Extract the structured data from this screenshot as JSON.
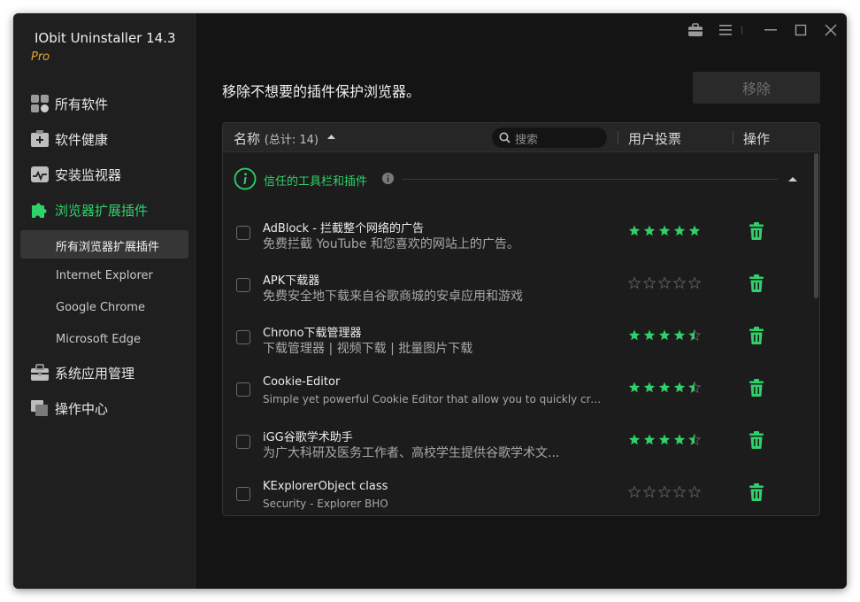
{
  "app": {
    "title": "IObit Uninstaller 14.3",
    "edition": "Pro"
  },
  "sidebar": {
    "items": [
      {
        "label": "所有软件",
        "icon": "grid-icon"
      },
      {
        "label": "软件健康",
        "icon": "medkit-icon"
      },
      {
        "label": "安装监视器",
        "icon": "monitor-icon"
      },
      {
        "label": "浏览器扩展插件",
        "icon": "puzzle-icon",
        "active": true
      },
      {
        "label": "系统应用管理",
        "icon": "briefcase-icon"
      },
      {
        "label": "操作中心",
        "icon": "flag-icon"
      }
    ],
    "subitems": [
      {
        "label": "所有浏览器扩展插件",
        "active": true
      },
      {
        "label": "Internet Explorer"
      },
      {
        "label": "Google Chrome"
      },
      {
        "label": "Microsoft Edge"
      }
    ]
  },
  "main": {
    "heading": "移除不想要的插件保护浏览器。",
    "remove_label": "移除"
  },
  "table": {
    "name_col": "名称",
    "count_label": "(总计: 14)",
    "search_placeholder": "搜索",
    "votes_col": "用户投票",
    "action_col": "操作",
    "group_label": "信任的工具栏和插件",
    "rows": [
      {
        "title": "AdBlock - 拦截整个网络的广告",
        "desc": "免费拦截 YouTube 和您喜欢的网站上的广告。",
        "rating": 5
      },
      {
        "title": "APK下载器",
        "desc": "免费安全地下载来自谷歌商城的安卓应用和游戏",
        "rating": 0
      },
      {
        "title": "Chrono下载管理器",
        "desc": "下载管理器 | 视频下载 | 批量图片下载",
        "rating": 4.5
      },
      {
        "title": "Cookie-Editor",
        "desc": "Simple yet powerful Cookie Editor that allow you to quickly crea...",
        "rating": 4.5
      },
      {
        "title": "iGG谷歌学术助手",
        "desc": "为广大科研及医务工作者、高校学生提供谷歌学术文...",
        "rating": 4.5
      },
      {
        "title": "KExplorerObject class",
        "desc": "Security - Explorer BHO",
        "rating": 0
      }
    ]
  },
  "colors": {
    "accent_green": "#2fd16a",
    "edition_gold": "#e0a82e",
    "background": "#141414",
    "sidebar": "#1f1f1f"
  }
}
